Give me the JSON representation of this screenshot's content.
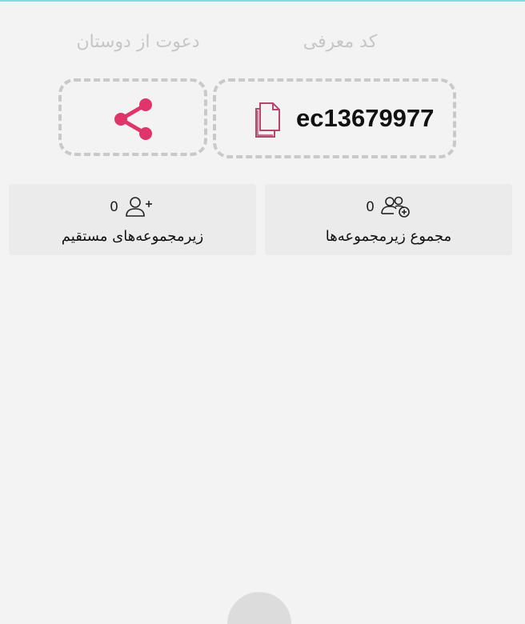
{
  "header": {
    "referral_code_label": "کد معرفی",
    "invite_friends_label": "دعوت از دوستان"
  },
  "referral": {
    "code": "ec13679977",
    "copy_icon": "copy-icon",
    "share_icon": "share-icon"
  },
  "stats": {
    "total": {
      "count": "0",
      "label": "مجموع زیرمجموعه‌ها",
      "icon": "users-add-icon"
    },
    "direct": {
      "count": "0",
      "label": "زیرمجموعه‌های مستقیم",
      "icon": "user-plus-icon"
    }
  },
  "colors": {
    "accent": "#e0356a",
    "copy_icon": "#b5476f",
    "muted_text": "#c6c6c6",
    "card_bg": "#ebebeb",
    "page_bg": "#f3f3f3",
    "dashed_border": "#c9c9c9"
  }
}
